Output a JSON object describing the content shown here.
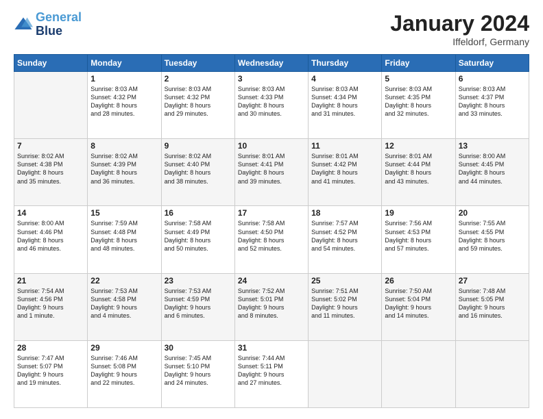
{
  "logo": {
    "line1": "General",
    "line2": "Blue"
  },
  "header": {
    "month": "January 2024",
    "location": "Iffeldorf, Germany"
  },
  "weekdays": [
    "Sunday",
    "Monday",
    "Tuesday",
    "Wednesday",
    "Thursday",
    "Friday",
    "Saturday"
  ],
  "weeks": [
    [
      {
        "day": "",
        "info": ""
      },
      {
        "day": "1",
        "info": "Sunrise: 8:03 AM\nSunset: 4:32 PM\nDaylight: 8 hours\nand 28 minutes."
      },
      {
        "day": "2",
        "info": "Sunrise: 8:03 AM\nSunset: 4:32 PM\nDaylight: 8 hours\nand 29 minutes."
      },
      {
        "day": "3",
        "info": "Sunrise: 8:03 AM\nSunset: 4:33 PM\nDaylight: 8 hours\nand 30 minutes."
      },
      {
        "day": "4",
        "info": "Sunrise: 8:03 AM\nSunset: 4:34 PM\nDaylight: 8 hours\nand 31 minutes."
      },
      {
        "day": "5",
        "info": "Sunrise: 8:03 AM\nSunset: 4:35 PM\nDaylight: 8 hours\nand 32 minutes."
      },
      {
        "day": "6",
        "info": "Sunrise: 8:03 AM\nSunset: 4:37 PM\nDaylight: 8 hours\nand 33 minutes."
      }
    ],
    [
      {
        "day": "7",
        "info": ""
      },
      {
        "day": "8",
        "info": "Sunrise: 8:02 AM\nSunset: 4:39 PM\nDaylight: 8 hours\nand 36 minutes."
      },
      {
        "day": "9",
        "info": "Sunrise: 8:02 AM\nSunset: 4:40 PM\nDaylight: 8 hours\nand 38 minutes."
      },
      {
        "day": "10",
        "info": "Sunrise: 8:01 AM\nSunset: 4:41 PM\nDaylight: 8 hours\nand 39 minutes."
      },
      {
        "day": "11",
        "info": "Sunrise: 8:01 AM\nSunset: 4:42 PM\nDaylight: 8 hours\nand 41 minutes."
      },
      {
        "day": "12",
        "info": "Sunrise: 8:01 AM\nSunset: 4:44 PM\nDaylight: 8 hours\nand 43 minutes."
      },
      {
        "day": "13",
        "info": "Sunrise: 8:00 AM\nSunset: 4:45 PM\nDaylight: 8 hours\nand 44 minutes."
      }
    ],
    [
      {
        "day": "14",
        "info": ""
      },
      {
        "day": "15",
        "info": "Sunrise: 7:59 AM\nSunset: 4:48 PM\nDaylight: 8 hours\nand 48 minutes."
      },
      {
        "day": "16",
        "info": "Sunrise: 7:58 AM\nSunset: 4:49 PM\nDaylight: 8 hours\nand 50 minutes."
      },
      {
        "day": "17",
        "info": "Sunrise: 7:58 AM\nSunset: 4:50 PM\nDaylight: 8 hours\nand 52 minutes."
      },
      {
        "day": "18",
        "info": "Sunrise: 7:57 AM\nSunset: 4:52 PM\nDaylight: 8 hours\nand 54 minutes."
      },
      {
        "day": "19",
        "info": "Sunrise: 7:56 AM\nSunset: 4:53 PM\nDaylight: 8 hours\nand 57 minutes."
      },
      {
        "day": "20",
        "info": "Sunrise: 7:55 AM\nSunset: 4:55 PM\nDaylight: 8 hours\nand 59 minutes."
      }
    ],
    [
      {
        "day": "21",
        "info": ""
      },
      {
        "day": "22",
        "info": "Sunrise: 7:53 AM\nSunset: 4:58 PM\nDaylight: 9 hours\nand 4 minutes."
      },
      {
        "day": "23",
        "info": "Sunrise: 7:53 AM\nSunset: 4:59 PM\nDaylight: 9 hours\nand 6 minutes."
      },
      {
        "day": "24",
        "info": "Sunrise: 7:52 AM\nSunset: 5:01 PM\nDaylight: 9 hours\nand 8 minutes."
      },
      {
        "day": "25",
        "info": "Sunrise: 7:51 AM\nSunset: 5:02 PM\nDaylight: 9 hours\nand 11 minutes."
      },
      {
        "day": "26",
        "info": "Sunrise: 7:50 AM\nSunset: 5:04 PM\nDaylight: 9 hours\nand 14 minutes."
      },
      {
        "day": "27",
        "info": "Sunrise: 7:48 AM\nSunset: 5:05 PM\nDaylight: 9 hours\nand 16 minutes."
      }
    ],
    [
      {
        "day": "28",
        "info": "Sunrise: 7:47 AM\nSunset: 5:07 PM\nDaylight: 9 hours\nand 19 minutes."
      },
      {
        "day": "29",
        "info": "Sunrise: 7:46 AM\nSunset: 5:08 PM\nDaylight: 9 hours\nand 22 minutes."
      },
      {
        "day": "30",
        "info": "Sunrise: 7:45 AM\nSunset: 5:10 PM\nDaylight: 9 hours\nand 24 minutes."
      },
      {
        "day": "31",
        "info": "Sunrise: 7:44 AM\nSunset: 5:11 PM\nDaylight: 9 hours\nand 27 minutes."
      },
      {
        "day": "",
        "info": ""
      },
      {
        "day": "",
        "info": ""
      },
      {
        "day": "",
        "info": ""
      }
    ]
  ],
  "week1_day7_info": "Sunrise: 8:02 AM\nSunset: 4:38 PM\nDaylight: 8 hours\nand 35 minutes.",
  "week2_day1_info": "Sunrise: 8:02 AM\nSunset: 4:38 PM\nDaylight: 8 hours\nand 35 minutes.",
  "week3_day1_info": "Sunrise: 8:00 AM\nSunset: 4:46 PM\nDaylight: 8 hours\nand 46 minutes.",
  "week4_day1_info": "Sunrise: 7:54 AM\nSunset: 4:56 PM\nDaylight: 9 hours\nand 1 minute."
}
